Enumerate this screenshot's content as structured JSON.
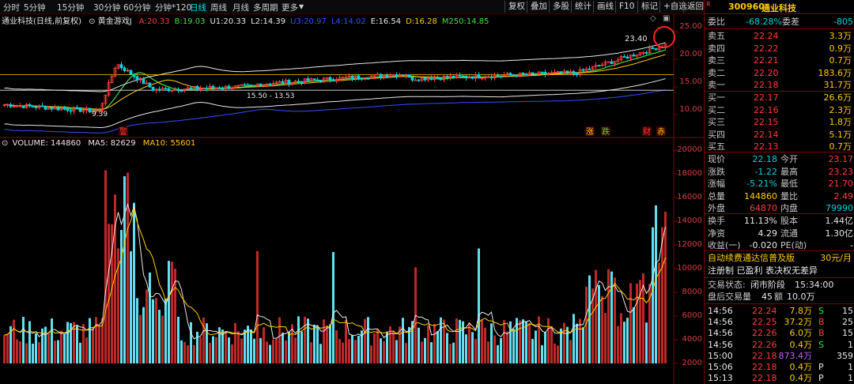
{
  "colors": {
    "up": "#ff3c3c",
    "down": "#00d0d8",
    "accent": "#ffcc00",
    "white": "#e8e8e8",
    "green": "#40e040",
    "purple": "#c060ff",
    "blue": "#3050ff",
    "grid": "#7a0000"
  },
  "toolbar": {
    "timeframes": [
      "分时",
      "5分钟",
      "15分钟",
      "30分钟",
      "60分钟",
      "分钟*120",
      "日线",
      "周线",
      "月线",
      "多周期",
      "更多"
    ],
    "active": "日线",
    "buttons": [
      "复权",
      "叠加",
      "多股",
      "统计",
      "画线",
      "F10",
      "标记",
      "+自选",
      "返回"
    ]
  },
  "chart": {
    "title": "通业科技(日线,前复权)",
    "indicator": "黄金游戏J",
    "vals": [
      {
        "k": "A:",
        "v": "20.33",
        "c": "#ff3c3c"
      },
      {
        "k": "B:",
        "v": "19.03",
        "c": "#40e040"
      },
      {
        "k": "U1:",
        "v": "20.33",
        "c": "#e8e8e8"
      },
      {
        "k": "L2:",
        "v": "14.39",
        "c": "#e8e8e8"
      },
      {
        "k": "U3:",
        "v": "20.97",
        "c": "#3050ff"
      },
      {
        "k": "L4:",
        "v": "14.02",
        "c": "#3050ff"
      },
      {
        "k": "E:",
        "v": "16.54",
        "c": "#e8e8e8"
      },
      {
        "k": "D:",
        "v": "16.28",
        "c": "#ffcc00"
      },
      {
        "k": "M250:",
        "v": "14.85",
        "c": "#40e040"
      }
    ],
    "price_axis": [
      "25.00",
      "20.00",
      "15.00",
      "10.00"
    ],
    "annotations": {
      "high": "23.40",
      "range": "15.50 - 13.53",
      "low": "9.39",
      "markers": [
        "警",
        "涨",
        "跌",
        "财",
        "赤"
      ]
    },
    "volume": {
      "label": "VOLUME: 144860",
      "ma5": "MA5: 82629",
      "ma10": "MA10: 55601",
      "axis": [
        "20000",
        "18000",
        "16000",
        "14000",
        "12000",
        "10000",
        "8000",
        "6000",
        "4000",
        "2000"
      ]
    }
  },
  "quote": {
    "code": "300960",
    "name": "通业科技",
    "weibi": {
      "label": "委比",
      "value": "-68.28%",
      "label2": "委差",
      "value2": "-805"
    },
    "sells": [
      {
        "label": "卖五",
        "price": "22.24",
        "vol": "3.3万"
      },
      {
        "label": "卖四",
        "price": "22.22",
        "vol": "0.9万"
      },
      {
        "label": "卖三",
        "price": "22.21",
        "vol": "0.7万"
      },
      {
        "label": "卖二",
        "price": "22.20",
        "vol": "183.6万"
      },
      {
        "label": "卖一",
        "price": "22.18",
        "vol": "31.7万"
      }
    ],
    "buys": [
      {
        "label": "买一",
        "price": "22.17",
        "vol": "26.6万"
      },
      {
        "label": "买二",
        "price": "22.16",
        "vol": "2.3万"
      },
      {
        "label": "买三",
        "price": "22.15",
        "vol": "1.8万"
      },
      {
        "label": "买四",
        "price": "22.14",
        "vol": "5.1万"
      },
      {
        "label": "买五",
        "price": "22.13",
        "vol": "0.7万"
      }
    ],
    "stats": [
      {
        "l1": "现价",
        "v1": "22.18",
        "c1": "#00d0d8",
        "l2": "今开",
        "v2": "23.17",
        "c2": "#ff3c3c"
      },
      {
        "l1": "涨跌",
        "v1": "-1.22",
        "c1": "#00d0d8",
        "l2": "最高",
        "v2": "23.23",
        "c2": "#ff3c3c"
      },
      {
        "l1": "涨幅",
        "v1": "-5.21%",
        "c1": "#00d0d8",
        "l2": "最低",
        "v2": "21.70",
        "c2": "#ff3c3c"
      },
      {
        "l1": "总量",
        "v1": "144860",
        "c1": "#ffcc00",
        "l2": "量比",
        "v2": "2.49",
        "c2": "#ff3c3c"
      },
      {
        "l1": "外盘",
        "v1": "64870",
        "c1": "#ff3c3c",
        "l2": "内盘",
        "v2": "79990",
        "c2": "#00d0d8"
      }
    ],
    "stats2": [
      {
        "l1": "换手",
        "v1": "11.13%",
        "l2": "股本",
        "v2": "1.44亿"
      },
      {
        "l1": "净资",
        "v1": "4.29",
        "l2": "流通",
        "v2": "1.30亿"
      },
      {
        "l1": "收益(一)",
        "v1": "-0.020",
        "l2": "PE(动)",
        "v2": "-"
      }
    ],
    "promo": "自动续费通达信普及版",
    "price_tag": "30元/月",
    "reg": "注册制 已盈利 表决权无差异",
    "status_label": "交易状态:",
    "status": "闭市阶段",
    "status_time": "15:34:00",
    "after_label": "盘后交易量",
    "after_vol": "45",
    "after_amt_label": "额",
    "after_amt": "10.0万",
    "trades": [
      {
        "time": "14:56",
        "price": "22.24",
        "vol": "7.8万",
        "flag": "S",
        "extra": "15"
      },
      {
        "time": "14:56",
        "price": "22.25",
        "vol": "37.2万",
        "flag": "B",
        "extra": "25"
      },
      {
        "time": "14:56",
        "price": "22.26",
        "vol": "6.0万",
        "flag": "B",
        "extra": "15"
      },
      {
        "time": "14:56",
        "price": "22.26",
        "vol": "0.4万",
        "flag": "S",
        "extra": "1"
      },
      {
        "time": "15:00",
        "price": "22.18",
        "vol": "873.4万",
        "flag": "",
        "extra": "359"
      },
      {
        "time": "15:06",
        "price": "22.18",
        "vol": "0.4万",
        "flag": "P",
        "extra": "1"
      },
      {
        "time": "15:13",
        "price": "22.18",
        "vol": "0.4万",
        "flag": "P",
        "extra": "1"
      }
    ]
  }
}
